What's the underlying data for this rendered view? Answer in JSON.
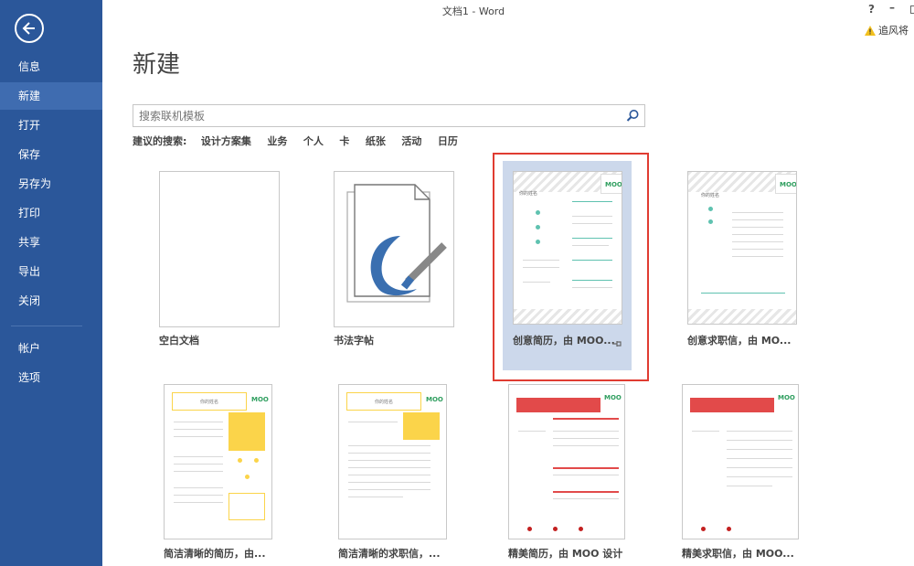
{
  "window": {
    "title": "文档1 - Word",
    "help": "?",
    "minimize": "–",
    "warning": "追风将"
  },
  "sidebar": {
    "items": [
      {
        "label": "信息"
      },
      {
        "label": "新建"
      },
      {
        "label": "打开"
      },
      {
        "label": "保存"
      },
      {
        "label": "另存为"
      },
      {
        "label": "打印"
      },
      {
        "label": "共享"
      },
      {
        "label": "导出"
      },
      {
        "label": "关闭"
      },
      {
        "label": "帐户"
      },
      {
        "label": "选项"
      }
    ]
  },
  "main": {
    "heading": "新建",
    "search": {
      "placeholder": "搜索联机模板",
      "value": ""
    },
    "suggested": {
      "label": "建议的搜索:",
      "tags": [
        "设计方案集",
        "业务",
        "个人",
        "卡",
        "纸张",
        "活动",
        "日历"
      ]
    },
    "templates": [
      {
        "label": "空白文档"
      },
      {
        "label": "书法字帖"
      },
      {
        "label": "创意简历，由 MOO..."
      },
      {
        "label": "创意求职信，由 MO..."
      },
      {
        "label": "简洁清晰的简历，由..."
      },
      {
        "label": "简洁清晰的求职信，..."
      },
      {
        "label": "精美简历，由 MOO 设计"
      },
      {
        "label": "精美求职信，由 MOO..."
      }
    ],
    "moo_logo": "MOO",
    "thumb_text": {
      "name": "你的姓名"
    }
  },
  "colors": {
    "sidebar": "#2b579a",
    "accent_red": "#e03c31",
    "moo_green": "#2e9e5e",
    "yellow": "#fbd44a"
  }
}
